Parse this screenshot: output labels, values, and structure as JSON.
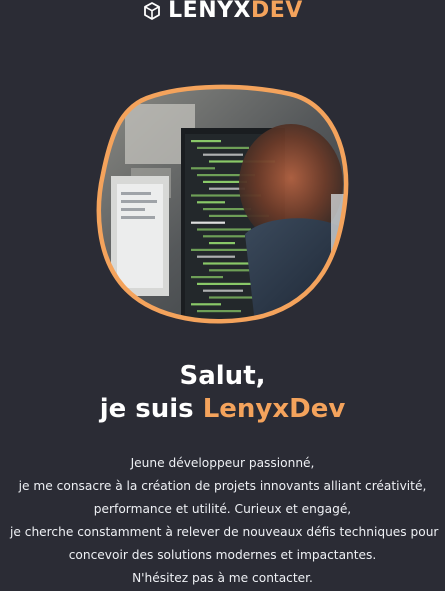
{
  "header": {
    "brand_primary": "LENYX",
    "brand_accent": "DEV",
    "logo_icon": "cube-icon"
  },
  "hero": {
    "image": "developer-coding-photo",
    "frame_color": "#f4a35c"
  },
  "intro": {
    "greeting": "Salut,",
    "prefix": "je suis ",
    "name": "LenyxDev"
  },
  "bio": {
    "lines": [
      "Jeune développeur passionné,",
      "je me consacre à la création de projets innovants alliant créativité,",
      "performance et utilité. Curieux et engagé,",
      "je cherche constamment à relever de nouveaux défis techniques pour",
      "concevoir des solutions modernes et impactantes.",
      "N'hésitez pas à me contacter."
    ]
  },
  "colors": {
    "background": "#2b2c35",
    "accent": "#f4a35c",
    "text": "#ffffff"
  }
}
